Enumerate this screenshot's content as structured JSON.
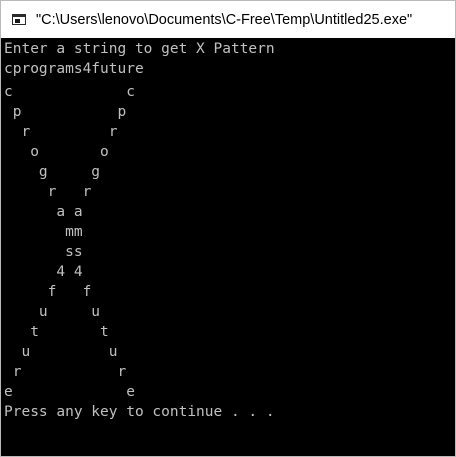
{
  "window": {
    "title": "\"C:\\Users\\lenovo\\Documents\\C-Free\\Temp\\Untitled25.exe\""
  },
  "console": {
    "lines": [
      "Enter a string to get X Pattern",
      "cprograms4future",
      "c             c",
      " p           p",
      "  r         r",
      "   o       o",
      "    g     g",
      "     r   r",
      "      a a",
      "       mm",
      "       ss",
      "      4 4",
      "     f   f",
      "    u     u",
      "   t       t",
      "  u         u",
      " r           r",
      "e             e",
      "Press any key to continue . . ."
    ]
  },
  "colors": {
    "console_background": "#000000",
    "console_text": "#c0c0c0",
    "titlebar_background": "#ffffff"
  }
}
